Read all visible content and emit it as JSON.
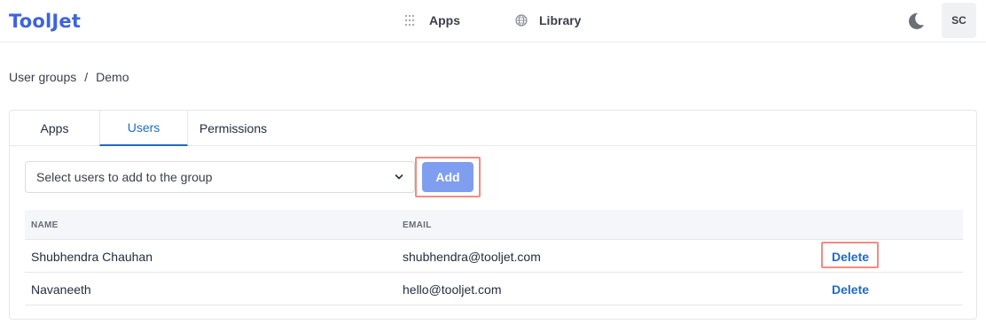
{
  "header": {
    "logo": "ToolJet",
    "nav": [
      {
        "label": "Apps",
        "icon": "grid-dots-icon"
      },
      {
        "label": "Library",
        "icon": "globe-icon"
      }
    ],
    "theme_icon": "moon-icon",
    "avatar_initials": "SC"
  },
  "breadcrumb": {
    "parent": "User groups",
    "separator": "/",
    "current": "Demo"
  },
  "tabs": [
    {
      "label": "Apps",
      "active": false
    },
    {
      "label": "Users",
      "active": true
    },
    {
      "label": "Permissions",
      "active": false
    }
  ],
  "add_users": {
    "select_placeholder": "Select users to add to the group",
    "add_label": "Add"
  },
  "table": {
    "columns": [
      "NAME",
      "EMAIL"
    ],
    "rows": [
      {
        "name": "Shubhendra Chauhan",
        "email": "shubhendra@tooljet.com",
        "action": "Delete"
      },
      {
        "name": "Navaneeth",
        "email": "hello@tooljet.com",
        "action": "Delete"
      }
    ]
  },
  "colors": {
    "brand": "#3e63dd",
    "link": "#206bc4",
    "add_button": "#7f9eef",
    "highlight_border": "#f28b82"
  }
}
